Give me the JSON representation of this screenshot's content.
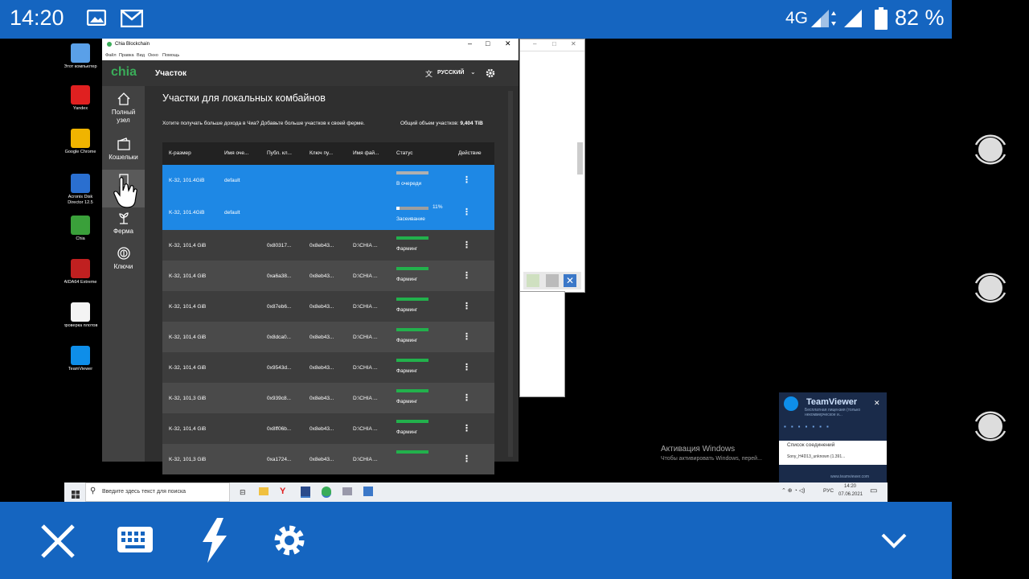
{
  "status_bar": {
    "time": "14:20",
    "network": "4G",
    "battery": "82 %"
  },
  "desktop_icons": [
    {
      "label": "Этот компьютер",
      "color": "#5aa0e8"
    },
    {
      "label": "Yandex",
      "color": "#e02020"
    },
    {
      "label": "Google Chrome",
      "color": "#f0b400"
    },
    {
      "label": "Acronis Disk Director 12.5",
      "color": "#2a6fd0"
    },
    {
      "label": "Chia",
      "color": "#3aa03a"
    },
    {
      "label": "AIDA64 Extreme",
      "color": "#c02020"
    },
    {
      "label": "проверка плотов",
      "color": "#f4f4f4"
    },
    {
      "label": "TeamViewer",
      "color": "#0e8ee9"
    }
  ],
  "chia_window": {
    "title": "Chia Blockchain",
    "menu": [
      "Файл",
      "Правка",
      "Вид",
      "Окно",
      "Помощь"
    ],
    "logo": "chia",
    "header_title": "Участок",
    "language": "РУССКИЙ",
    "sidebar": [
      {
        "label": "Полный узел"
      },
      {
        "label": "Кошельки"
      },
      {
        "label": "Уч..."
      },
      {
        "label": "Ферма"
      },
      {
        "label": "Ключи"
      }
    ],
    "page_title": "Участки для локальных комбайнов",
    "info_left": "Хотите получать больше дохода в Чиа? Добавьте больше участков к своей ферме.",
    "info_right_label": "Общий объем участков:",
    "info_right_value": "9,404 TiB",
    "columns": [
      "К-размер",
      "Имя оче...",
      "Публ. кл...",
      "Ключ пу...",
      "Имя фай...",
      "Статус",
      "Действие"
    ],
    "rows": [
      {
        "size": "K-32, 101.4GiB",
        "queue": "default",
        "pub": "",
        "key": "",
        "file": "",
        "status": "В очереди",
        "progress": "",
        "fill": 0,
        "type": "queue"
      },
      {
        "size": "K-32, 101.4GiB",
        "queue": "default",
        "pub": "",
        "key": "",
        "file": "",
        "status": "Засеивание",
        "progress": "11%",
        "fill": 0.11,
        "type": "plotting"
      },
      {
        "size": "K-32, 101,4 GiB",
        "queue": "",
        "pub": "0x80317...",
        "key": "0x8eb43...",
        "file": "D:\\CHIA ...",
        "status": "Фарминг",
        "progress": "",
        "fill": 1,
        "type": "farm"
      },
      {
        "size": "K-32, 101,4 GiB",
        "queue": "",
        "pub": "0xa6a38...",
        "key": "0x8eb43...",
        "file": "D:\\CHIA ...",
        "status": "Фарминг",
        "progress": "",
        "fill": 1,
        "type": "farm"
      },
      {
        "size": "K-32, 101,4 GiB",
        "queue": "",
        "pub": "0x87eb6...",
        "key": "0x8eb43...",
        "file": "D:\\CHIA ...",
        "status": "Фарминг",
        "progress": "",
        "fill": 1,
        "type": "farm"
      },
      {
        "size": "K-32, 101,4 GiB",
        "queue": "",
        "pub": "0x8dca0...",
        "key": "0x8eb43...",
        "file": "D:\\CHIA ...",
        "status": "Фарминг",
        "progress": "",
        "fill": 1,
        "type": "farm"
      },
      {
        "size": "K-32, 101,4 GiB",
        "queue": "",
        "pub": "0x9543d...",
        "key": "0x8eb43...",
        "file": "D:\\CHIA ...",
        "status": "Фарминг",
        "progress": "",
        "fill": 1,
        "type": "farm"
      },
      {
        "size": "K-32, 101,3 GiB",
        "queue": "",
        "pub": "0x939c8...",
        "key": "0x8eb43...",
        "file": "D:\\CHIA ...",
        "status": "Фарминг",
        "progress": "",
        "fill": 1,
        "type": "farm"
      },
      {
        "size": "K-32, 101,4 GiB",
        "queue": "",
        "pub": "0x8ff06b...",
        "key": "0x8eb43...",
        "file": "D:\\CHIA ...",
        "status": "Фарминг",
        "progress": "",
        "fill": 1,
        "type": "farm"
      },
      {
        "size": "K-32, 101,3 GiB",
        "queue": "",
        "pub": "0xa1724...",
        "key": "0x8eb43...",
        "file": "D:\\CHIA ...",
        "status": "",
        "progress": "",
        "fill": 1,
        "type": "farm"
      }
    ]
  },
  "activation": {
    "title": "Активация Windows",
    "text": "Чтобы активировать Windows, перей..."
  },
  "teamviewer": {
    "title": "TeamViewer",
    "subtitle": "Бесплатная лицензия (только некоммерческое и...",
    "list_title": "Список соединений",
    "session": "Sony_H4D13_unknown (1.391...",
    "link": "www.teamviewer.com"
  },
  "taskbar": {
    "search_placeholder": "Введите здесь текст для поиска",
    "lang": "РУС",
    "time": "14:20",
    "date": "07.06.2021"
  },
  "colors": {
    "android_blue": "#1565c0",
    "chia_green": "#3aac59",
    "selected_row": "#1e88e5",
    "farm_bar": "#22b14c"
  }
}
